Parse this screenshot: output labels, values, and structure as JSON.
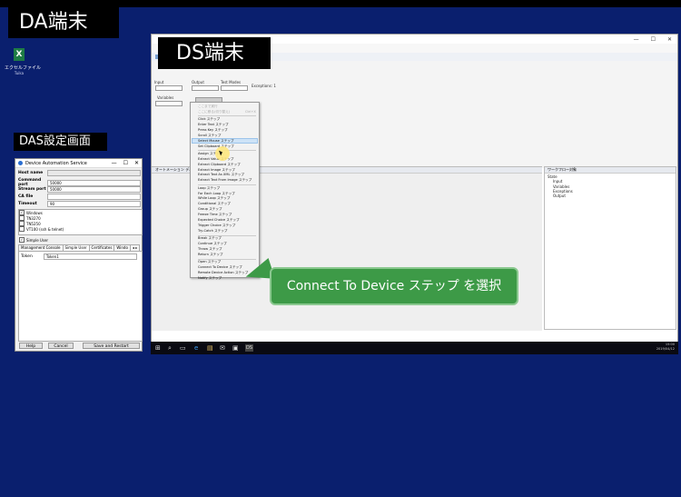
{
  "labels": {
    "da": "DA端末",
    "ds": "DS端末",
    "das": "DAS設定画面"
  },
  "desktop_icon": {
    "name": "エクセルファイル",
    "sub": "Tuika"
  },
  "das_window": {
    "title": "Device Automation Service",
    "controls": [
      "—",
      "☐",
      "✕"
    ],
    "fields": [
      {
        "label": "Host name",
        "value": ""
      },
      {
        "label": "Command port",
        "value": "50000"
      },
      {
        "label": "Stream port",
        "value": "50000"
      },
      {
        "label": "CA file",
        "value": ""
      },
      {
        "label": "Timeout",
        "value": "90"
      }
    ],
    "checks": [
      {
        "label": "Windows",
        "checked": true
      },
      {
        "label": "TN3270",
        "checked": false
      },
      {
        "label": "TN5250",
        "checked": false
      },
      {
        "label": "VT100 (ssh & telnet)",
        "checked": false
      }
    ],
    "simple_user": "Simple User",
    "tabs": [
      "Management Console",
      "Simple User",
      "Certificates",
      "Windo"
    ],
    "tab_arrows": "◂ ▸",
    "token_label": "Token",
    "token_value": "Token1",
    "buttons": {
      "help": "Help",
      "cancel": "Cancel",
      "save": "Save and Restart"
    }
  },
  "ds_window": {
    "controls": [
      "—",
      "☐",
      "✕"
    ],
    "flow": {
      "input": "Input",
      "output": "Output",
      "test_modes": "Test Modes",
      "exceptions": "Exceptions: 1",
      "variables": "Variables"
    },
    "lower_header": "オートメーション ディバッグ",
    "right_header": "ワークフロー対象",
    "tree": [
      "State",
      "Input",
      "Variables",
      "Exceptions",
      "Output"
    ]
  },
  "context_menu": {
    "items_disabled": [
      "ここまで実行",
      "ここに移る(切り替え)"
    ],
    "shortcut": "Ctrl+X",
    "items": [
      "Click ステップ",
      "Enter Text ステップ",
      "Press Key ステップ",
      "Scroll ステップ",
      "Select Mouse ステップ",
      "Set Clipboard ステップ",
      "Assign ステップ",
      "Extract Value ステップ",
      "Extract Clipboard ステップ",
      "Extract Image ステップ",
      "Extract Text As XML ステップ",
      "Extract Text From Image ステップ",
      "Loop ステップ",
      "For Each Loop ステップ",
      "While Loop ステップ",
      "Conditional ステップ",
      "Group ステップ",
      "Freeze Time ステップ",
      "Expected Choice ステップ",
      "Trigger Choice ステップ",
      "Try-Catch ステップ",
      "Break ステップ",
      "Continue ステップ",
      "Throw ステップ",
      "Return ステップ",
      "Open ステップ",
      "Connect To Device ステップ",
      "Remote Device Action ステップ",
      "Notify ステップ"
    ]
  },
  "callout": {
    "text": "Connect To Device ステップ を選択"
  },
  "taskbar": {
    "items": [
      "⊞",
      "⌕",
      "▭",
      "e",
      "▤",
      "✉",
      "▣",
      "DS"
    ],
    "time": "15:00",
    "date": "2019/04/12"
  }
}
